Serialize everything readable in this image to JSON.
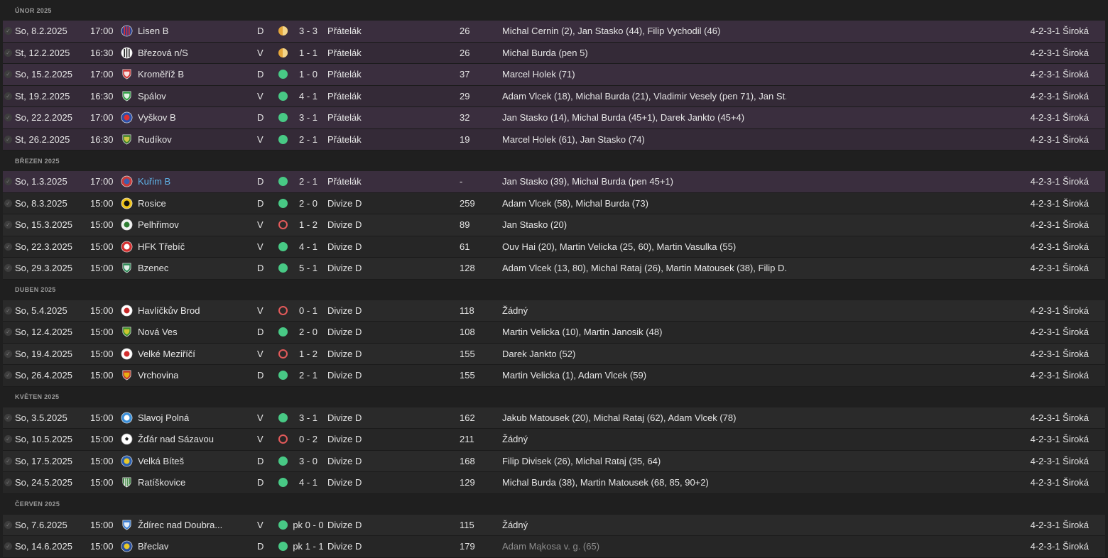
{
  "months": [
    {
      "label": "ÚNOR 2025",
      "matches": [
        {
          "date": "So, 8.2.2025",
          "time": "17:00",
          "team": "Lisen B",
          "crest": "stripes-red-crest",
          "crest_colors": [
            "#2a3f8f",
            "#e03030"
          ],
          "venue": "D",
          "result": "draw",
          "score": "3 - 3",
          "competition": "Přátelák",
          "attendance": "26",
          "scorers": "Michal Cernin (2), Jan Stasko (44), Filip Vychodil (46)",
          "formation": "4-2-3-1 Široká",
          "highlight": true
        },
        {
          "date": "St, 12.2.2025",
          "time": "16:30",
          "team": "Březová n/S",
          "crest": "stripes-bw-crest",
          "crest_colors": [
            "#ffffff",
            "#222222"
          ],
          "venue": "V",
          "result": "draw",
          "score": "1 - 1",
          "competition": "Přátelák",
          "attendance": "26",
          "scorers": "Michal Burda (pen 5)",
          "formation": "4-2-3-1 Široká",
          "highlight": true
        },
        {
          "date": "So, 15.2.2025",
          "time": "17:00",
          "team": "Kroměříž B",
          "crest": "shield-red-crest",
          "crest_colors": [
            "#d23434",
            "#ffffff"
          ],
          "venue": "D",
          "result": "win",
          "score": "1 - 0",
          "competition": "Přátelák",
          "attendance": "37",
          "scorers": "Marcel Holek (71)",
          "formation": "4-2-3-1 Široká",
          "highlight": true
        },
        {
          "date": "St, 19.2.2025",
          "time": "16:30",
          "team": "Spálov",
          "crest": "shield-green-crest",
          "crest_colors": [
            "#2f9e44",
            "#ffffff"
          ],
          "venue": "V",
          "result": "win",
          "score": "4 - 1",
          "competition": "Přátelák",
          "attendance": "29",
          "scorers": "Adam Vlcek (18), Michal Burda (21), Vladimir Vesely (pen 71), Jan St...",
          "formation": "4-2-3-1 Široká",
          "highlight": true
        },
        {
          "date": "So, 22.2.2025",
          "time": "17:00",
          "team": "Vyškov B",
          "crest": "round-blue-red-crest",
          "crest_colors": [
            "#2c4fa8",
            "#e03030"
          ],
          "venue": "D",
          "result": "win",
          "score": "3 - 1",
          "competition": "Přátelák",
          "attendance": "32",
          "scorers": "Jan Stasko (14), Michal Burda (45+1), Darek Jankto (45+4)",
          "formation": "4-2-3-1 Široká",
          "highlight": true
        },
        {
          "date": "St, 26.2.2025",
          "time": "16:30",
          "team": "Rudíkov",
          "crest": "shield-green-yellow-crest",
          "crest_colors": [
            "#3b7d2a",
            "#e8d24a"
          ],
          "venue": "V",
          "result": "win",
          "score": "2 - 1",
          "competition": "Přátelák",
          "attendance": "19",
          "scorers": "Marcel Holek (61), Jan Stasko (74)",
          "formation": "4-2-3-1 Široká",
          "highlight": true
        }
      ]
    },
    {
      "label": "BŘEZEN 2025",
      "matches": [
        {
          "date": "So, 1.3.2025",
          "time": "17:00",
          "team": "Kuřim B",
          "crest": "round-red-blue-crest",
          "crest_colors": [
            "#c93b3b",
            "#3b5fb0"
          ],
          "venue": "D",
          "result": "win",
          "score": "2 - 1",
          "competition": "Přátelák",
          "attendance": "-",
          "scorers": "Jan Stasko (39), Michal Burda (pen 45+1)",
          "formation": "4-2-3-1 Široká",
          "highlight": true,
          "link": true
        },
        {
          "date": "So, 8.3.2025",
          "time": "15:00",
          "team": "Rosice",
          "crest": "round-yellow-black-crest",
          "crest_colors": [
            "#f0c419",
            "#111111"
          ],
          "venue": "D",
          "result": "win",
          "score": "2 - 0",
          "competition": "Divize D",
          "attendance": "259",
          "scorers": "Adam Vlcek (58), Michal Burda (73)",
          "formation": "4-2-3-1 Široká"
        },
        {
          "date": "So, 15.3.2025",
          "time": "15:00",
          "team": "Pelhřimov",
          "crest": "round-white-green-crest",
          "crest_colors": [
            "#f2f2f2",
            "#2e7d32"
          ],
          "venue": "V",
          "result": "loss",
          "score": "1 - 2",
          "competition": "Divize D",
          "attendance": "89",
          "scorers": "Jan Stasko (20)",
          "formation": "4-2-3-1 Široká"
        },
        {
          "date": "So, 22.3.2025",
          "time": "15:00",
          "team": "HFK Třebíč",
          "crest": "round-red-white-crest",
          "crest_colors": [
            "#d32f2f",
            "#ffffff"
          ],
          "venue": "V",
          "result": "win",
          "score": "4 - 1",
          "competition": "Divize D",
          "attendance": "61",
          "scorers": "Ouv Hai (20), Martin Velicka (25, 60), Martin Vasulka (55)",
          "formation": "4-2-3-1 Široká"
        },
        {
          "date": "So, 29.3.2025",
          "time": "15:00",
          "team": "Bzenec",
          "crest": "shield-green-white-crest",
          "crest_colors": [
            "#2e8b57",
            "#ffffff"
          ],
          "venue": "D",
          "result": "win",
          "score": "5 - 1",
          "competition": "Divize D",
          "attendance": "128",
          "scorers": "Adam Vlcek (13, 80), Michal Rataj (26), Martin Matousek (38), Filip D...",
          "formation": "4-2-3-1 Široká"
        }
      ]
    },
    {
      "label": "DUBEN 2025",
      "matches": [
        {
          "date": "So, 5.4.2025",
          "time": "15:00",
          "team": "Havlíčkův Brod",
          "crest": "round-white-red-crest",
          "crest_colors": [
            "#ffffff",
            "#c62828"
          ],
          "venue": "V",
          "result": "loss",
          "score": "0 - 1",
          "competition": "Divize D",
          "attendance": "118",
          "scorers": "Žádný",
          "formation": "4-2-3-1 Široká"
        },
        {
          "date": "So, 12.4.2025",
          "time": "15:00",
          "team": "Nová Ves",
          "crest": "shield-green-yellow-crest",
          "crest_colors": [
            "#3f8f2f",
            "#e5d02f"
          ],
          "venue": "D",
          "result": "win",
          "score": "2 - 0",
          "competition": "Divize D",
          "attendance": "108",
          "scorers": "Martin Velicka (10), Martin Janosik (48)",
          "formation": "4-2-3-1 Široká"
        },
        {
          "date": "So, 19.4.2025",
          "time": "15:00",
          "team": "Velké Meziříčí",
          "crest": "round-white-red-crest",
          "crest_colors": [
            "#ffffff",
            "#d32f2f"
          ],
          "venue": "V",
          "result": "loss",
          "score": "1 - 2",
          "competition": "Divize D",
          "attendance": "155",
          "scorers": "Darek Jankto (52)",
          "formation": "4-2-3-1 Široká"
        },
        {
          "date": "So, 26.4.2025",
          "time": "15:00",
          "team": "Vrchovina",
          "crest": "shield-red-yellow-crest",
          "crest_colors": [
            "#c0392b",
            "#f1c40f"
          ],
          "venue": "D",
          "result": "win",
          "score": "2 - 1",
          "competition": "Divize D",
          "attendance": "155",
          "scorers": "Martin Velicka (1), Adam Vlcek (59)",
          "formation": "4-2-3-1 Široká"
        }
      ]
    },
    {
      "label": "KVĚTEN 2025",
      "matches": [
        {
          "date": "So, 3.5.2025",
          "time": "15:00",
          "team": "Slavoj Polná",
          "crest": "round-blue-white-crest",
          "crest_colors": [
            "#3a8fd9",
            "#ffffff"
          ],
          "venue": "V",
          "result": "win",
          "score": "3 - 1",
          "competition": "Divize D",
          "attendance": "162",
          "scorers": "Jakub Matousek (20), Michal Rataj (62), Adam Vlcek (78)",
          "formation": "4-2-3-1 Široká"
        },
        {
          "date": "So, 10.5.2025",
          "time": "15:00",
          "team": "Žďár nad Sázavou",
          "crest": "ball-crest",
          "crest_colors": [
            "#ffffff",
            "#222222"
          ],
          "venue": "V",
          "result": "loss",
          "score": "0 - 2",
          "competition": "Divize D",
          "attendance": "211",
          "scorers": "Žádný",
          "formation": "4-2-3-1 Široká"
        },
        {
          "date": "So, 17.5.2025",
          "time": "15:00",
          "team": "Velká Bíteš",
          "crest": "round-blue-yellow-crest",
          "crest_colors": [
            "#2a5fb0",
            "#e8c82a"
          ],
          "venue": "D",
          "result": "win",
          "score": "3 - 0",
          "competition": "Divize D",
          "attendance": "168",
          "scorers": "Filip Divisek (26), Michal Rataj (35, 64)",
          "formation": "4-2-3-1 Široká"
        },
        {
          "date": "So, 24.5.2025",
          "time": "15:00",
          "team": "Ratíškovice",
          "crest": "shield-stripes-green-crest",
          "crest_colors": [
            "#2e7d32",
            "#f2f2f2"
          ],
          "venue": "D",
          "result": "win",
          "score": "4 - 1",
          "competition": "Divize D",
          "attendance": "129",
          "scorers": "Michal Burda (38), Martin Matousek (68, 85, 90+2)",
          "formation": "4-2-3-1 Široká"
        }
      ]
    },
    {
      "label": "ČERVEN 2025",
      "matches": [
        {
          "date": "So, 7.6.2025",
          "time": "15:00",
          "team": "Ždírec nad Doubra...",
          "crest": "shield-blue-white-crest",
          "crest_colors": [
            "#3a7fd5",
            "#ffffff"
          ],
          "venue": "V",
          "result": "win",
          "score": "pk 0 - 0",
          "competition": "Divize D",
          "attendance": "115",
          "scorers": "Žádný",
          "formation": "4-2-3-1 Široká"
        },
        {
          "date": "So, 14.6.2025",
          "time": "15:00",
          "team": "Břeclav",
          "crest": "round-blue-yellow-crest",
          "crest_colors": [
            "#2a4f9c",
            "#e8c82a"
          ],
          "venue": "D",
          "result": "win",
          "score": "pk 1 - 1",
          "competition": "Divize D",
          "attendance": "179",
          "scorers": "Adam Mąkosa v. g. (65)",
          "formation": "4-2-3-1 Široká",
          "muted_scorers": true
        }
      ]
    }
  ]
}
